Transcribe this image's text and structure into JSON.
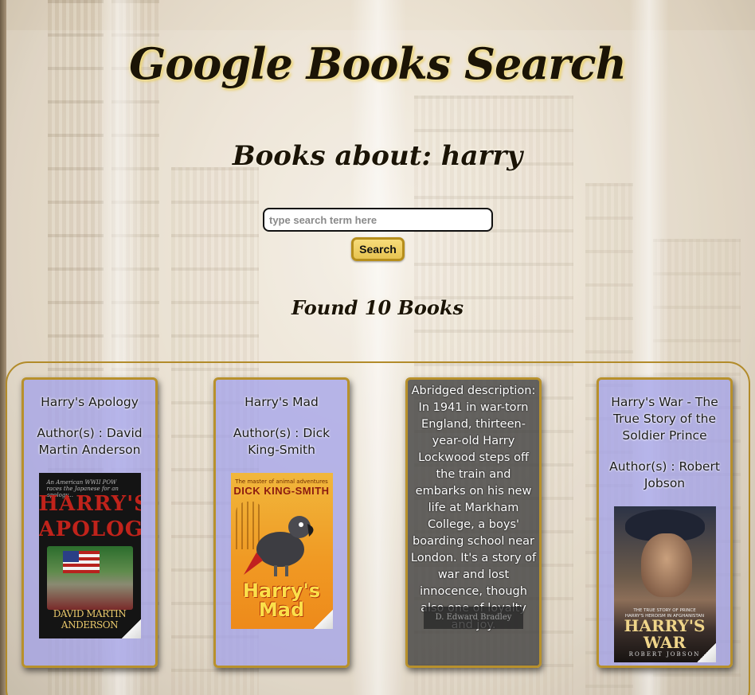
{
  "header": {
    "title": "Google Books Search",
    "subtitle": "Books about: harry"
  },
  "search": {
    "placeholder": "type search term here",
    "value": "",
    "button_label": "Search"
  },
  "results": {
    "count_text": "Found 10 Books",
    "cards": [
      {
        "title": "Harry's Apology",
        "author": "Author(s) : David Martin Anderson",
        "cover": {
          "tagline": "An American WWII POW races the Japanese for an apology...",
          "title_line1": "HARRY'S",
          "title_line2": "APOLOGY",
          "author": "DAVID MARTIN ANDERSON"
        }
      },
      {
        "title": "Harry's Mad",
        "author": "Author(s) : Dick King-Smith",
        "cover": {
          "tagline": "The master of animal adventures",
          "author": "DICK KING-SMITH",
          "title_line1": "Harry's",
          "title_line2": "Mad"
        }
      },
      {
        "description": "Abridged description: In 1941 in war-torn England, thirteen-year-old Harry Lockwood steps off the train and embarks on his new life at Markham College, a boys' boarding school near London. It's a story of war and lost innocence, though also one of loyalty and joy.",
        "hidden_author": "D. Edward Bradley"
      },
      {
        "title": "Harry's War - The True Story of the Soldier Prince",
        "author": "Author(s) : Robert Jobson",
        "cover": {
          "subtitle_line1": "THE TRUE STORY OF PRINCE",
          "subtitle_line2": "HARRY'S HEROISM IN AFGHANISTAN",
          "title_line1": "HARRY'S",
          "title_line2": "WAR",
          "author": "ROBERT JOBSON"
        }
      }
    ]
  },
  "colors": {
    "accent_gold": "#b8912c",
    "card_bg": "#a0a0eb",
    "button_bg": "#e7c451"
  }
}
